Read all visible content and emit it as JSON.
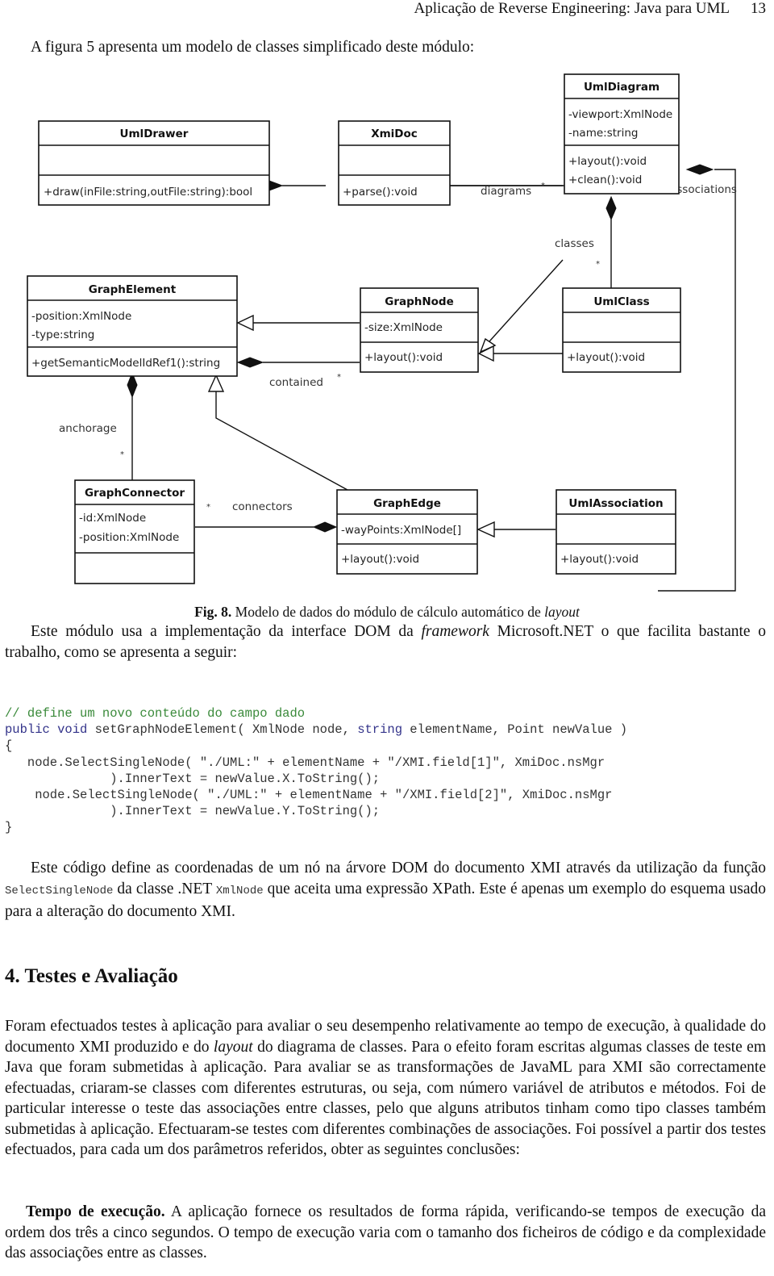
{
  "header": {
    "running_title": "Aplicação de Reverse Engineering: Java para UML",
    "page_number": "13"
  },
  "intro": "A figura 5 apresenta um modelo de classes simplificado deste módulo:",
  "figure": {
    "classes": {
      "UmlDrawer": {
        "name": "UmlDrawer",
        "attributes": [],
        "methods": [
          "+draw(inFile:string,outFile:string):bool"
        ]
      },
      "XmiDoc": {
        "name": "XmiDoc",
        "attributes": [],
        "methods": [
          "+parse():void"
        ]
      },
      "UmlDiagram": {
        "name": "UmlDiagram",
        "attributes": [
          "-viewport:XmlNode",
          "-name:string"
        ],
        "methods": [
          "+layout():void",
          "+clean():void"
        ]
      },
      "GraphElement": {
        "name": "GraphElement",
        "attributes": [
          "-position:XmlNode",
          "-type:string"
        ],
        "methods": [
          "+getSemanticModelIdRef1():string"
        ]
      },
      "GraphNode": {
        "name": "GraphNode",
        "attributes": [
          "-size:XmlNode"
        ],
        "methods": [
          "+layout():void"
        ]
      },
      "UmlClass": {
        "name": "UmlClass",
        "attributes": [],
        "methods": [
          "+layout():void"
        ]
      },
      "GraphConnector": {
        "name": "GraphConnector",
        "attributes": [
          "-id:XmlNode",
          "-position:XmlNode"
        ],
        "methods": []
      },
      "GraphEdge": {
        "name": "GraphEdge",
        "attributes": [
          "-wayPoints:XmlNode[]"
        ],
        "methods": [
          "+layout():void"
        ]
      },
      "UmlAssociation": {
        "name": "UmlAssociation",
        "attributes": [],
        "methods": [
          "+layout():void"
        ]
      }
    },
    "labels": {
      "diagrams": "diagrams",
      "associations": "associations",
      "classes": "classes",
      "contained": "contained",
      "anchorage": "anchorage",
      "connectors": "connectors",
      "many": "*"
    },
    "relations": [
      {
        "type": "composition",
        "whole": "UmlDrawer",
        "part": "XmiDoc"
      },
      {
        "type": "composition",
        "whole": "XmiDoc",
        "part": "UmlDiagram",
        "role": "diagrams",
        "multiplicity": "*"
      },
      {
        "type": "generalization",
        "child": "UmlDiagram",
        "parent": "GraphNode"
      },
      {
        "type": "composition",
        "whole": "UmlDiagram",
        "part": "UmlClass",
        "role": "classes",
        "multiplicity": "*"
      },
      {
        "type": "composition",
        "whole": "UmlDiagram",
        "part": "UmlAssociation",
        "role": "associations",
        "multiplicity": "*"
      },
      {
        "type": "generalization",
        "child": "GraphNode",
        "parent": "GraphElement"
      },
      {
        "type": "composition",
        "whole": "GraphElement",
        "part": "GraphNode",
        "role": "contained",
        "multiplicity": "*"
      },
      {
        "type": "generalization",
        "child": "UmlClass",
        "parent": "GraphNode"
      },
      {
        "type": "composition",
        "whole": "GraphElement",
        "part": "GraphConnector",
        "role": "anchorage",
        "multiplicity": "*"
      },
      {
        "type": "generalization",
        "child": "GraphEdge",
        "parent": "GraphElement"
      },
      {
        "type": "composition",
        "whole": "GraphEdge",
        "part": "GraphConnector",
        "role": "connectors",
        "multiplicity": "*"
      },
      {
        "type": "generalization",
        "child": "UmlAssociation",
        "parent": "GraphEdge"
      }
    ],
    "caption_label": "Fig. 8.",
    "caption_text": " Modelo de dados do módulo de cálculo automático de ",
    "caption_italic": "layout"
  },
  "para1": {
    "before": "Este módulo usa a implementação da interface DOM da ",
    "italic": "framework",
    "after": " Microsoft.NET o que facilita bastante o trabalho, como se apresenta a seguir:"
  },
  "code": {
    "comment": "// define um novo conteúdo do campo dado",
    "kw_public_void": "public void",
    "sig_a": " setGraphNodeElement( XmlNode node, ",
    "kw_string": "string",
    "sig_b": " elementName, Point newValue )",
    "open_brace": "{",
    "line1": "   node.SelectSingleNode( \"./UML:\" + elementName + \"/XMI.field[1]\", XmiDoc.nsMgr",
    "line2": "              ).InnerText = newValue.X.ToString();",
    "line3": "    node.SelectSingleNode( \"./UML:\" + elementName + \"/XMI.field[2]\", XmiDoc.nsMgr",
    "line4": "              ).InnerText = newValue.Y.ToString();",
    "close_brace": "}"
  },
  "para2": {
    "a": "Este código define as coordenadas de um nó na árvore DOM do documento XMI através da utilização da função ",
    "code1": "SelectSingleNode",
    "b": " da classe .NET ",
    "code2": "XmlNode",
    "c": " que aceita uma expressão XPath. Este é apenas um exemplo do esquema usado para a alteração do documento XMI."
  },
  "section": {
    "title": "4. Testes e Avaliação"
  },
  "para3": {
    "a": "Foram efectuados testes à aplicação para avaliar o seu desempenho relativamente ao tempo de execução, à qualidade do documento XMI produzido e do ",
    "italic": "layout",
    "b": " do diagrama de classes. Para o efeito foram escritas algumas classes de teste em Java que foram submetidas à aplicação. Para avaliar se as transformações de JavaML para XMI são correctamente efectuadas, criaram-se classes com diferentes estruturas, ou seja, com número variável de atributos e métodos. Foi de particular interesse o teste das associações entre classes, pelo que alguns atributos tinham como tipo classes também submetidas à aplicação. Efectuaram-se testes com diferentes combinações de associações. Foi possível a partir dos testes efectuados, para cada um dos parâmetros referidos, obter as seguintes conclusões:"
  },
  "para4": {
    "bold": "Tempo de execução.",
    "text": " A aplicação fornece os resultados de forma rápida, verificando-se tempos de execução da ordem dos três a cinco segundos. O tempo de execução varia com o tamanho dos ficheiros de código e da complexidade das associações entre as classes."
  }
}
